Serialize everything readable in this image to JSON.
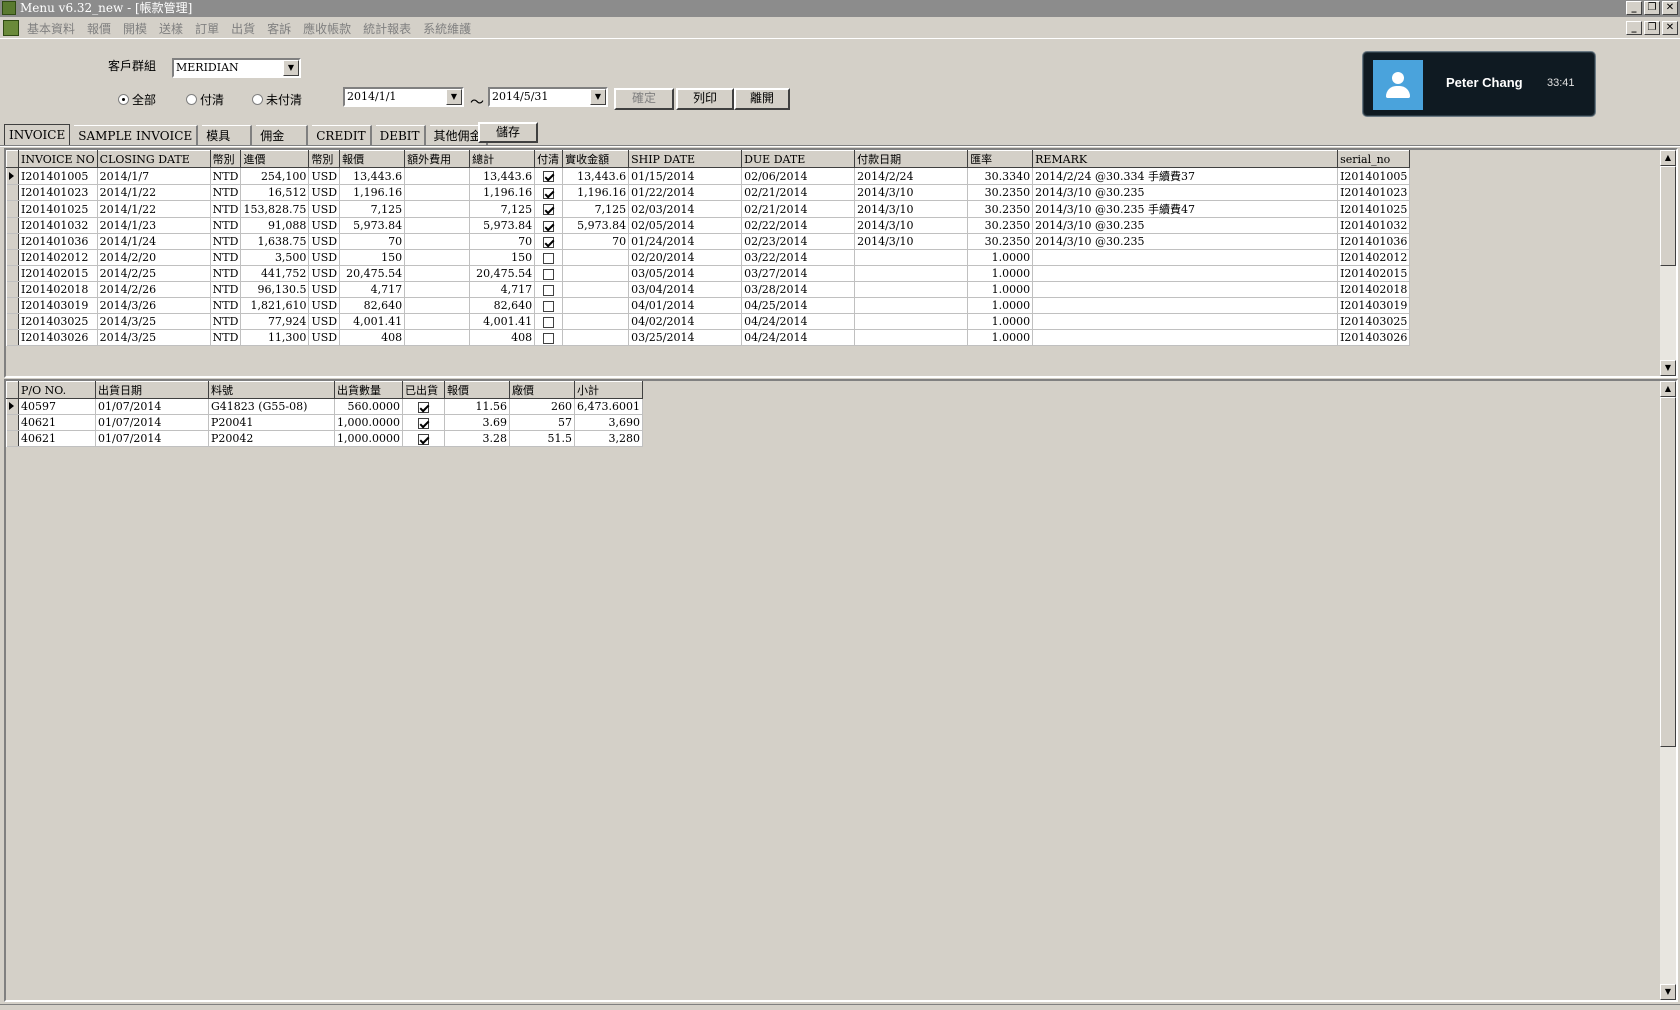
{
  "window": {
    "title": "Menu v6.32_new - [帳款管理]",
    "buttons": [
      "_",
      "❐",
      "✕"
    ]
  },
  "menubar": {
    "items": [
      "基本資料",
      "報價",
      "開模",
      "送樣",
      "訂單",
      "出貨",
      "客訴",
      "應收帳款",
      "統計報表",
      "系統維護"
    ]
  },
  "filter": {
    "customer_group_label": "客戶群組",
    "customer_group_value": "MERIDIAN",
    "radios": [
      {
        "label": "全部",
        "checked": true
      },
      {
        "label": "付清",
        "checked": false
      },
      {
        "label": "未付清",
        "checked": false
      }
    ],
    "date_from": "2014/1/1",
    "date_sep": "～",
    "date_to": "2014/5/31",
    "confirm_label": "確定",
    "print_label": "列印",
    "exit_label": "離開"
  },
  "user_widget": {
    "name": "Peter Chang",
    "time": "33:41"
  },
  "tabs": {
    "items": [
      "INVOICE",
      "SAMPLE INVOICE",
      "模具",
      "佣金",
      "CREDIT",
      "DEBIT",
      "其他佣金"
    ],
    "active": 0,
    "save_label": "儲存"
  },
  "invoice_grid": {
    "columns": [
      "INVOICE NO",
      "CLOSING DATE",
      "幣別",
      "進價",
      "幣別",
      "報價",
      "額外費用",
      "總計",
      "付清",
      "實收金額",
      "SHIP DATE",
      "DUE DATE",
      "付款日期",
      "匯率",
      "REMARK",
      "serial_no"
    ],
    "rows": [
      [
        "I201401005",
        "2014/1/7",
        "NTD",
        "254,100",
        "USD",
        "13,443.6",
        "",
        "13,443.6",
        true,
        "13,443.6",
        "01/15/2014",
        "02/06/2014",
        "2014/2/24",
        "30.3340",
        "2014/2/24 @30.334 手續費37",
        "I201401005"
      ],
      [
        "I201401023",
        "2014/1/22",
        "NTD",
        "16,512",
        "USD",
        "1,196.16",
        "",
        "1,196.16",
        true,
        "1,196.16",
        "01/22/2014",
        "02/21/2014",
        "2014/3/10",
        "30.2350",
        "2014/3/10 @30.235",
        "I201401023"
      ],
      [
        "I201401025",
        "2014/1/22",
        "NTD",
        "153,828.75",
        "USD",
        "7,125",
        "",
        "7,125",
        true,
        "7,125",
        "02/03/2014",
        "02/21/2014",
        "2014/3/10",
        "30.2350",
        "2014/3/10 @30.235 手續費47",
        "I201401025"
      ],
      [
        "I201401032",
        "2014/1/23",
        "NTD",
        "91,088",
        "USD",
        "5,973.84",
        "",
        "5,973.84",
        true,
        "5,973.84",
        "02/05/2014",
        "02/22/2014",
        "2014/3/10",
        "30.2350",
        "2014/3/10 @30.235",
        "I201401032"
      ],
      [
        "I201401036",
        "2014/1/24",
        "NTD",
        "1,638.75",
        "USD",
        "70",
        "",
        "70",
        true,
        "70",
        "01/24/2014",
        "02/23/2014",
        "2014/3/10",
        "30.2350",
        "2014/3/10 @30.235",
        "I201401036"
      ],
      [
        "I201402012",
        "2014/2/20",
        "NTD",
        "3,500",
        "USD",
        "150",
        "",
        "150",
        false,
        "",
        "02/20/2014",
        "03/22/2014",
        "",
        "1.0000",
        "",
        "I201402012"
      ],
      [
        "I201402015",
        "2014/2/25",
        "NTD",
        "441,752",
        "USD",
        "20,475.54",
        "",
        "20,475.54",
        false,
        "",
        "03/05/2014",
        "03/27/2014",
        "",
        "1.0000",
        "",
        "I201402015"
      ],
      [
        "I201402018",
        "2014/2/26",
        "NTD",
        "96,130.5",
        "USD",
        "4,717",
        "",
        "4,717",
        false,
        "",
        "03/04/2014",
        "03/28/2014",
        "",
        "1.0000",
        "",
        "I201402018"
      ],
      [
        "I201403019",
        "2014/3/26",
        "NTD",
        "1,821,610",
        "USD",
        "82,640",
        "",
        "82,640",
        false,
        "",
        "04/01/2014",
        "04/25/2014",
        "",
        "1.0000",
        "",
        "I201403019"
      ],
      [
        "I201403025",
        "2014/3/25",
        "NTD",
        "77,924",
        "USD",
        "4,001.41",
        "",
        "4,001.41",
        false,
        "",
        "04/02/2014",
        "04/24/2014",
        "",
        "1.0000",
        "",
        "I201403025"
      ],
      [
        "I201403026",
        "2014/3/25",
        "NTD",
        "11,300",
        "USD",
        "408",
        "",
        "408",
        false,
        "",
        "03/25/2014",
        "04/24/2014",
        "",
        "1.0000",
        "",
        "I201403026"
      ]
    ]
  },
  "detail_grid": {
    "columns": [
      "P/O NO.",
      "出貨日期",
      "料號",
      "出貨數量",
      "已出貨",
      "報價",
      "廠價",
      "小計"
    ],
    "rows": [
      [
        "40597",
        "01/07/2014",
        "G41823 (G55-08)",
        "560.0000",
        true,
        "11.56",
        "260",
        "6,473.6001"
      ],
      [
        "40621",
        "01/07/2014",
        "P20041",
        "1,000.0000",
        true,
        "3.69",
        "57",
        "3,690"
      ],
      [
        "40621",
        "01/07/2014",
        "P20042",
        "1,000.0000",
        true,
        "3.28",
        "51.5",
        "3,280"
      ]
    ]
  },
  "scroll_arrows": {
    "up": "▲",
    "down": "▼"
  },
  "dropdown_arrow": "▼"
}
